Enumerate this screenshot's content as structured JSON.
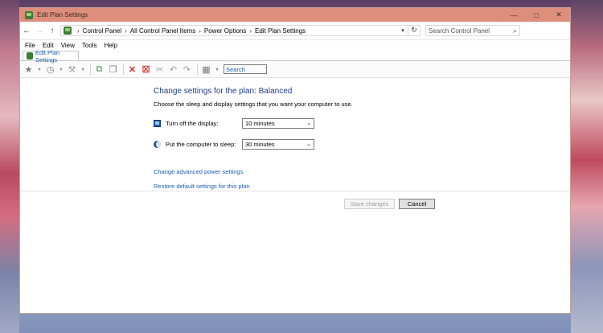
{
  "window": {
    "title": "Edit Plan Settings",
    "controls": {
      "minimize": "—",
      "maximize": "□",
      "close": "✕"
    }
  },
  "address_bar": {
    "back_icon": "←",
    "forward_icon": "→",
    "up_icon": "↑",
    "breadcrumbs": [
      "Control Panel",
      "All Control Panel Items",
      "Power Options",
      "Edit Plan Settings"
    ],
    "separator": "›",
    "dropdown_icon": "▾",
    "refresh_icon": "↻",
    "search_placeholder": "Search Control Panel",
    "search_icon": "⌕"
  },
  "menu": {
    "items": [
      "File",
      "Edit",
      "View",
      "Tools",
      "Help"
    ]
  },
  "tab": {
    "label": "Edit Plan Settings"
  },
  "toolbar": {
    "search_placeholder": "Search"
  },
  "content": {
    "heading": "Change settings for the plan: Balanced",
    "subtitle": "Choose the sleep and display settings that you want your computer to use.",
    "display_setting": {
      "label": "Turn off the display:",
      "value": "10 minutes"
    },
    "sleep_setting": {
      "label": "Put the computer to sleep:",
      "value": "30 minutes"
    },
    "links": {
      "advanced": "Change advanced power settings",
      "restore": "Restore default settings for this plan"
    },
    "buttons": {
      "save": "Save changes",
      "cancel": "Cancel"
    }
  },
  "colors": {
    "title_bar": "#dd8f7c",
    "heading": "#1e3a8a",
    "link": "#1a5fb4"
  }
}
